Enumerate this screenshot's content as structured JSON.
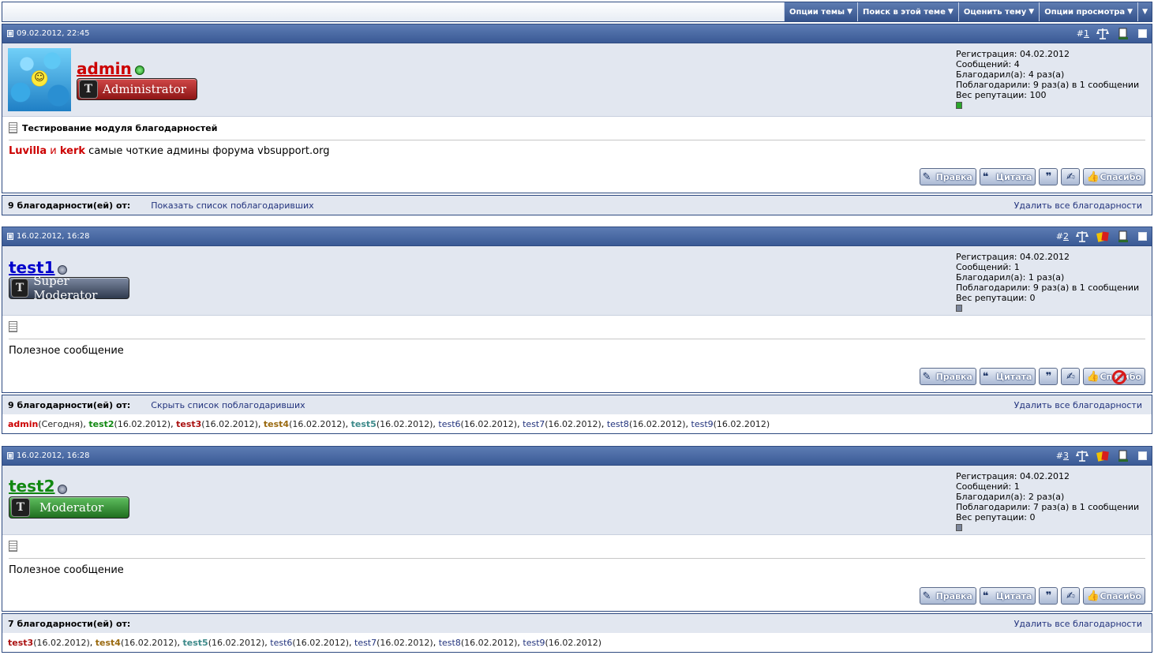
{
  "toolbar": {
    "menus": [
      {
        "label": "Опции темы"
      },
      {
        "label": "Поиск в этой теме"
      },
      {
        "label": "Оценить тему"
      },
      {
        "label": "Опции просмотра"
      }
    ]
  },
  "posts": [
    {
      "date": "09.02.2012, 22:45",
      "num_prefix": "#",
      "num": "1",
      "username": "admin",
      "username_color": "#cc0000",
      "online": true,
      "rank": "Administrator",
      "rank_color": "#a32222",
      "info": {
        "reg": "Регистрация: 04.02.2012",
        "posts": "Сообщений: 4",
        "thanked": "Благодарил(а): 4 раз(а)",
        "thanked_by": "Поблагодарили: 9 раз(а) в 1 сообщении",
        "rep": "Вес репутации: 100"
      },
      "rep_color": "#2aa52a",
      "title": "Тестирование модуля благодарностей",
      "text_part1": "Luvilla",
      "text_and": " и ",
      "text_part2": "kerk",
      "text_rest": " самые чоткие админы форума vbsupport.org",
      "buttons": {
        "edit": "Правка",
        "quote": "Цитата",
        "thanks": "Спасибо"
      }
    },
    {
      "date": "16.02.2012, 16:28",
      "num_prefix": "#",
      "num": "2",
      "username": "test1",
      "username_color": "#0000cc",
      "online": false,
      "rank": "Super Moderator",
      "rank_color": "#3e4a5e",
      "info": {
        "reg": "Регистрация: 04.02.2012",
        "posts": "Сообщений: 1",
        "thanked": "Благодарил(а): 1 раз(а)",
        "thanked_by": "Поблагодарили: 9 раз(а) в 1 сообщении",
        "rep": "Вес репутации: 0"
      },
      "rep_color": "#7c869a",
      "title": "",
      "text": "Полезное сообщение",
      "buttons": {
        "edit": "Правка",
        "quote": "Цитата",
        "thanks": "Спасибо"
      }
    },
    {
      "date": "16.02.2012, 16:28",
      "num_prefix": "#",
      "num": "3",
      "username": "test2",
      "username_color": "#118811",
      "online": false,
      "rank": "Moderator",
      "rank_color": "#2f8a2f",
      "info": {
        "reg": "Регистрация: 04.02.2012",
        "posts": "Сообщений: 1",
        "thanked": "Благодарил(а): 2 раз(а)",
        "thanked_by": "Поблагодарили: 7 раз(а) в 1 сообщении",
        "rep": "Вес репутации: 0"
      },
      "rep_color": "#7c869a",
      "title": "",
      "text": "Полезное сообщение",
      "buttons": {
        "edit": "Правка",
        "quote": "Цитата",
        "thanks": "Спасибо"
      }
    }
  ],
  "thanks": [
    {
      "count": "9 благодарности(ей) от:",
      "toggle": "Показать список поблагодаривших",
      "delete": "Удалить все благодарности",
      "users": []
    },
    {
      "count": "9 благодарности(ей) от:",
      "toggle": "Скрыть список поблагодаривших",
      "delete": "Удалить все благодарности",
      "users": [
        {
          "name": "admin",
          "date": "(Сегодня)",
          "color": "#cc0000",
          "bold": true
        },
        {
          "name": "test2",
          "date": "(16.02.2012)",
          "color": "#118811",
          "bold": true
        },
        {
          "name": "test3",
          "date": "(16.02.2012)",
          "color": "#aa1111",
          "bold": true
        },
        {
          "name": "test4",
          "date": "(16.02.2012)",
          "color": "#9a6a10",
          "bold": true
        },
        {
          "name": "test5",
          "date": "(16.02.2012)",
          "color": "#3d8a8a",
          "bold": true
        },
        {
          "name": "test6",
          "date": "(16.02.2012)",
          "color": "#22337d",
          "bold": false
        },
        {
          "name": "test7",
          "date": "(16.02.2012)",
          "color": "#22337d",
          "bold": false
        },
        {
          "name": "test8",
          "date": "(16.02.2012)",
          "color": "#22337d",
          "bold": false
        },
        {
          "name": "test9",
          "date": "(16.02.2012)",
          "color": "#22337d",
          "bold": false
        }
      ]
    },
    {
      "count": "7 благодарности(ей) от:",
      "toggle": "",
      "delete": "Удалить все благодарности",
      "users": [
        {
          "name": "test3",
          "date": "(16.02.2012)",
          "color": "#aa1111",
          "bold": true
        },
        {
          "name": "test4",
          "date": "(16.02.2012)",
          "color": "#9a6a10",
          "bold": true
        },
        {
          "name": "test5",
          "date": "(16.02.2012)",
          "color": "#3d8a8a",
          "bold": true
        },
        {
          "name": "test6",
          "date": "(16.02.2012)",
          "color": "#22337d",
          "bold": false
        },
        {
          "name": "test7",
          "date": "(16.02.2012)",
          "color": "#22337d",
          "bold": false
        },
        {
          "name": "test8",
          "date": "(16.02.2012)",
          "color": "#22337d",
          "bold": false
        },
        {
          "name": "test9",
          "date": "(16.02.2012)",
          "color": "#22337d",
          "bold": false
        }
      ]
    }
  ]
}
